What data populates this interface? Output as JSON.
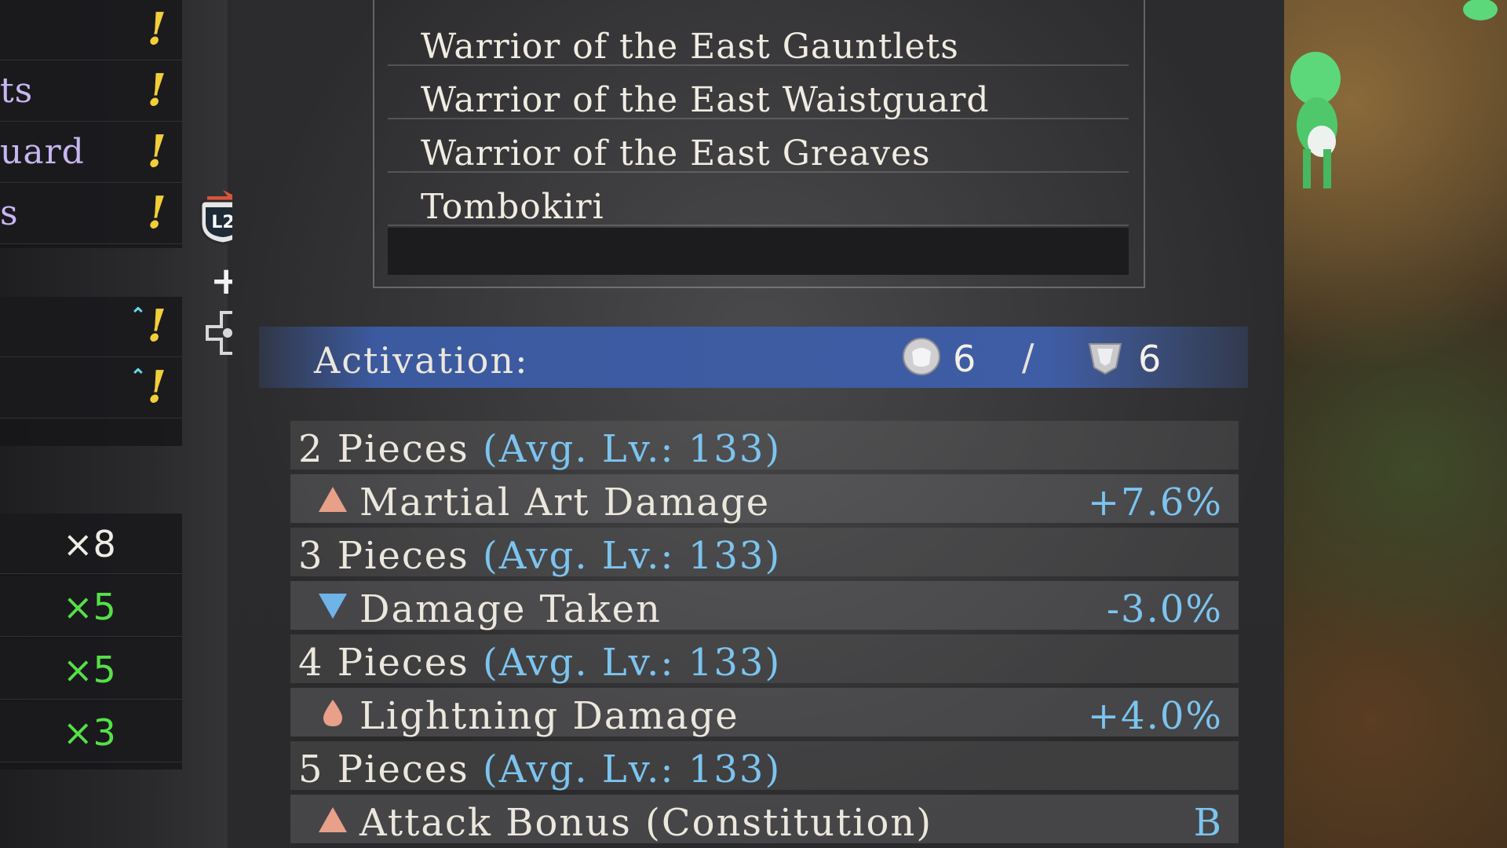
{
  "left_list": {
    "item_rows": [
      {
        "label": "",
        "indicator": "!"
      },
      {
        "label": "ts",
        "indicator": "!"
      },
      {
        "label": "uard",
        "indicator": "!"
      },
      {
        "label": "s",
        "indicator": "!"
      }
    ],
    "upgrade_rows": [
      {
        "indicator": "!"
      },
      {
        "indicator": "!"
      }
    ],
    "counts": [
      {
        "text": "×8",
        "color": "#f0ede6"
      },
      {
        "text": "×5",
        "color": "#56e048"
      },
      {
        "text": "×5",
        "color": "#56e048"
      },
      {
        "text": "×3",
        "color": "#56e048"
      }
    ]
  },
  "controls": {
    "l2_label": "L2",
    "plus": "+"
  },
  "set_items": [
    "Warrior of the East Gauntlets",
    "Warrior of the East Waistguard",
    "Warrior of the East Greaves",
    "Tombokiri"
  ],
  "activation": {
    "label": "Activation:",
    "value_a": "6",
    "separator": "/",
    "value_b": "6"
  },
  "bonuses": [
    {
      "pieces": "2 Pieces",
      "avg": "(Avg. Lv.: 133)",
      "icon": "triangle-up-icon",
      "icon_color": "#e8a088",
      "effect": "Martial Art Damage",
      "value": "+7.6%"
    },
    {
      "pieces": "3 Pieces",
      "avg": "(Avg. Lv.: 133)",
      "icon": "triangle-down-icon",
      "icon_color": "#6fb4e8",
      "effect": "Damage Taken",
      "value": "-3.0%"
    },
    {
      "pieces": "4 Pieces",
      "avg": "(Avg. Lv.: 133)",
      "icon": "drop-icon",
      "icon_color": "#e8a088",
      "effect": "Lightning Damage",
      "value": "+4.0%"
    },
    {
      "pieces": "5 Pieces",
      "avg": "(Avg. Lv.: 133)",
      "icon": "triangle-up-icon",
      "icon_color": "#e8a088",
      "effect": "Attack Bonus (Constitution)",
      "value": "B"
    }
  ]
}
